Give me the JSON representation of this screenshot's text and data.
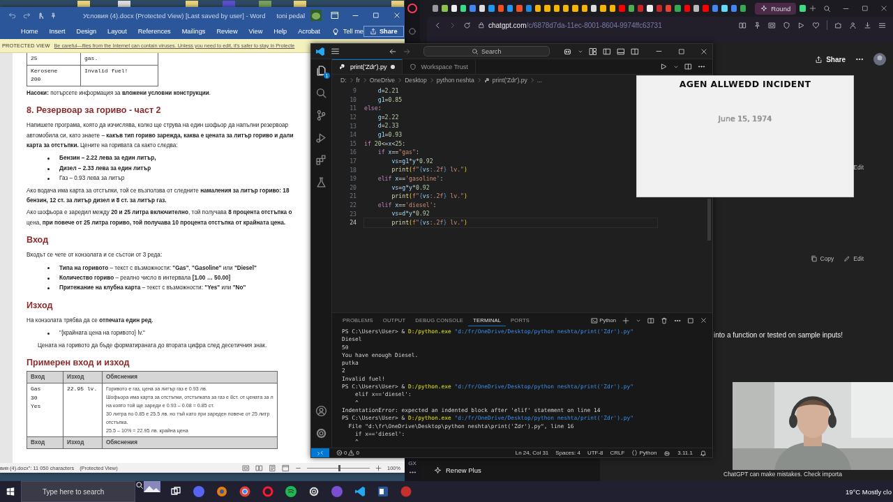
{
  "word": {
    "title": "Условия (4).docx (Protected View) [Last saved by user]  -  Word",
    "user": "toni pedal",
    "ribbon_tabs": [
      "Home",
      "Insert",
      "Design",
      "Layout",
      "References",
      "Mailings",
      "Review",
      "View",
      "Help",
      "Acrobat"
    ],
    "tell_me": "Tell me",
    "share": "Share",
    "protected_view": {
      "label": "PROTECTED VIEW",
      "message": "Be careful—files from the Internet can contain viruses. Unless you need to edit, it's safer to stay in Protecte"
    },
    "document": [
      {
        "kind": "table",
        "rows": [
          {
            "header": false,
            "cells": [
              "25",
              "gas."
            ]
          },
          {
            "header": false,
            "cells": [
              "Kerosene\n200",
              "Invalid fuel!"
            ]
          }
        ]
      },
      {
        "kind": "paragraph",
        "lines": [
          "**Насоки:** потърсете информация за **вложени условни конструкции**."
        ]
      },
      {
        "kind": "heading",
        "text": "8. Резервоар за гориво -  част 2"
      },
      {
        "kind": "paragraph",
        "lines": [
          "Напишете програма, която да изчислява, колко ще струва на един шофьор да напълни резервоар",
          "автомобила си, като знаете – **какъв тип гориво зарежда, каква е цената за литър гориво и дали**",
          "**карта за отстъпки.** Цените на горивата са както следва:"
        ]
      },
      {
        "kind": "bullets",
        "items": [
          "**Бензин – 2.22 лева за един литър,**",
          "**Дизел – 2.33 лева за един литър**",
          "Газ – 0.93 лева за литър"
        ]
      },
      {
        "kind": "paragraph",
        "lines": [
          "Ако водача има карта за отстъпки,  той се възползва от следните **намаления за литър гориво: 18**",
          "**бензин, 12 ст. за литър дизел и 8 ст. за литър газ.**"
        ]
      },
      {
        "kind": "paragraph",
        "lines": [
          "Ако шофьора е заредил между **20 и 25 литра включително**, той получава **8 процента отстъпка о**",
          "цена, **при повече от 25 литра гориво, той получава 10 процента отстъпка от крайната цена.**"
        ]
      },
      {
        "kind": "heading",
        "text": "Вход"
      },
      {
        "kind": "paragraph",
        "lines": [
          "Входът се чете от конзолата и се състои от 3 реда:"
        ]
      },
      {
        "kind": "bullets",
        "items": [
          "**Типа на горивото** – текст с възможности: **\"Gas\"**, **\"Gasoline\"** или **\"Diesel\"**",
          "**Количество гориво** – реално число в интервала **[1.00 … 50.00]**",
          "**Притежание на клубна карта** – текст с възможности: **\"Yes\"** или **\"No\"**"
        ]
      },
      {
        "kind": "heading",
        "text": "Изход"
      },
      {
        "kind": "paragraph",
        "lines": [
          "На конзолата трябва да се **отпечата един ред**."
        ]
      },
      {
        "kind": "bullets",
        "items": [
          "\"{крайната цена на горивото} lv.\""
        ]
      },
      {
        "kind": "note",
        "lines": [
          "Цената на горивото да бъде форматираната до втората цифра след десетичния знак."
        ]
      },
      {
        "kind": "heading",
        "text": "Примерен вход и изход"
      },
      {
        "kind": "table",
        "rows": [
          {
            "header": true,
            "cells": [
              "Вход",
              "Изход",
              "Обяснения"
            ]
          },
          {
            "header": false,
            "cells": [
              "Gas\n30\nYes",
              "22.95 lv.",
              "Горивото е газ, цена за литър газ е 0.93 лв.\nШофьора има карта за отстъпки, отстъпката за газ е 8ст. от цената за л\nна която той ще зареди е 0.93 – 0.08 = 0.85 ст.\n30 литра по 0.85 е 25.5 лв. но тъй като при зареден повече от 25 литр\nотстъпка.\n25.5 – 10% = 22.95 лв. крайна цена"
            ]
          },
          {
            "header": true,
            "cells": [
              "Вход",
              "Изход",
              "Обяснения"
            ]
          }
        ]
      }
    ],
    "status_bar": {
      "document_info": "вия (4).docx\": 11 050 characters",
      "mode": "(Protected View)",
      "zoom": "100%",
      "zoom_slider": {
        "level": 0.5
      }
    }
  },
  "browser": {
    "active_tab": "Round",
    "url_host": "chatgpt.com",
    "url_path": "/c/6878d7da-11ec-8001-8604-9974ffc63731",
    "sidebar_label": "GX",
    "renew": "Renew Plus",
    "share": "Share",
    "side_edit": "Edit",
    "message_actions": [
      "Copy",
      "Edit"
    ],
    "reply_fragment": "into a function or tested on sample inputs!",
    "disclaimer": "ChatGPT can make mistakes. Check importa"
  },
  "vscode": {
    "search": "Search",
    "explorer_badge": "1",
    "tabs": [
      {
        "label": "print('Zdr').py",
        "kind": "file",
        "selected": true,
        "modified": true
      },
      {
        "label": "Workspace Trust",
        "kind": "trust",
        "selected": false,
        "modified": false
      }
    ],
    "breadcrumb": [
      "D:",
      "fr",
      "OneDrive",
      "Desktop",
      "python neshta",
      "print('Zdr').py",
      "..."
    ],
    "code": [
      {
        "number": "9",
        "current": false,
        "tokens": [
          {
            "text": "    d",
            "kind": "var"
          },
          {
            "text": "=",
            "kind": "plain"
          },
          {
            "text": "2.21",
            "kind": "num"
          }
        ]
      },
      {
        "number": "10",
        "current": false,
        "tokens": [
          {
            "text": "    g1",
            "kind": "var"
          },
          {
            "text": "=",
            "kind": "plain"
          },
          {
            "text": "0.85",
            "kind": "num"
          }
        ]
      },
      {
        "number": "11",
        "current": false,
        "tokens": [
          {
            "text": "else",
            "kind": "kw"
          },
          {
            "text": ":",
            "kind": "plain"
          }
        ]
      },
      {
        "number": "12",
        "current": false,
        "tokens": [
          {
            "text": "    g",
            "kind": "var"
          },
          {
            "text": "=",
            "kind": "plain"
          },
          {
            "text": "2.22",
            "kind": "num"
          }
        ]
      },
      {
        "number": "13",
        "current": false,
        "tokens": [
          {
            "text": "    d",
            "kind": "var"
          },
          {
            "text": "=",
            "kind": "plain"
          },
          {
            "text": "2.33",
            "kind": "num"
          }
        ]
      },
      {
        "number": "14",
        "current": false,
        "tokens": [
          {
            "text": "    g1",
            "kind": "var"
          },
          {
            "text": "=",
            "kind": "plain"
          },
          {
            "text": "0.93",
            "kind": "num"
          }
        ]
      },
      {
        "number": "15",
        "current": false,
        "tokens": [
          {
            "text": "if",
            "kind": "kw"
          },
          {
            "text": " 20",
            "kind": "num"
          },
          {
            "text": "<=",
            "kind": "plain"
          },
          {
            "text": "x",
            "kind": "var"
          },
          {
            "text": "<",
            "kind": "plain"
          },
          {
            "text": "25",
            "kind": "num"
          },
          {
            "text": ":",
            "kind": "plain"
          }
        ]
      },
      {
        "number": "16",
        "current": false,
        "tokens": [
          {
            "text": "    if",
            "kind": "kw"
          },
          {
            "text": " x",
            "kind": "var"
          },
          {
            "text": "==",
            "kind": "plain"
          },
          {
            "text": "\"gas\"",
            "kind": "str"
          },
          {
            "text": ":",
            "kind": "plain"
          }
        ]
      },
      {
        "number": "17",
        "current": false,
        "tokens": [
          {
            "text": "        vs",
            "kind": "var"
          },
          {
            "text": "=",
            "kind": "plain"
          },
          {
            "text": "g1",
            "kind": "var"
          },
          {
            "text": "*",
            "kind": "plain"
          },
          {
            "text": "y",
            "kind": "var"
          },
          {
            "text": "*",
            "kind": "plain"
          },
          {
            "text": "0.92",
            "kind": "num"
          }
        ]
      },
      {
        "number": "18",
        "current": false,
        "tokens": [
          {
            "text": "        print",
            "kind": "fn"
          },
          {
            "text": "(",
            "kind": "bracket"
          },
          {
            "text": "f\"",
            "kind": "str"
          },
          {
            "text": "{",
            "kind": "fmt"
          },
          {
            "text": "vs",
            "kind": "var"
          },
          {
            "text": ":.2f",
            "kind": "str"
          },
          {
            "text": "}",
            "kind": "fmt"
          },
          {
            "text": " lv.\"",
            "kind": "str"
          },
          {
            "text": ")",
            "kind": "bracket"
          }
        ]
      },
      {
        "number": "19",
        "current": false,
        "tokens": [
          {
            "text": "    elif",
            "kind": "kw"
          },
          {
            "text": " x",
            "kind": "var"
          },
          {
            "text": "==",
            "kind": "plain"
          },
          {
            "text": "'gasoline'",
            "kind": "str"
          },
          {
            "text": ":",
            "kind": "plain"
          }
        ]
      },
      {
        "number": "20",
        "current": false,
        "tokens": [
          {
            "text": "        vs",
            "kind": "var"
          },
          {
            "text": "=",
            "kind": "plain"
          },
          {
            "text": "g",
            "kind": "var"
          },
          {
            "text": "*",
            "kind": "plain"
          },
          {
            "text": "y",
            "kind": "var"
          },
          {
            "text": "*",
            "kind": "plain"
          },
          {
            "text": "0.92",
            "kind": "num"
          }
        ]
      },
      {
        "number": "21",
        "current": false,
        "tokens": [
          {
            "text": "        print",
            "kind": "fn"
          },
          {
            "text": "(",
            "kind": "bracket"
          },
          {
            "text": "f\"",
            "kind": "str"
          },
          {
            "text": "{",
            "kind": "fmt"
          },
          {
            "text": "vs",
            "kind": "var"
          },
          {
            "text": ":.2f",
            "kind": "str"
          },
          {
            "text": "}",
            "kind": "fmt"
          },
          {
            "text": " lv.\"",
            "kind": "str"
          },
          {
            "text": ")",
            "kind": "bracket"
          }
        ]
      },
      {
        "number": "22",
        "current": false,
        "tokens": [
          {
            "text": "    elif",
            "kind": "kw"
          },
          {
            "text": " x",
            "kind": "var"
          },
          {
            "text": "==",
            "kind": "plain"
          },
          {
            "text": "'diesel'",
            "kind": "str"
          },
          {
            "text": ":",
            "kind": "plain"
          }
        ]
      },
      {
        "number": "23",
        "current": false,
        "tokens": [
          {
            "text": "        vs",
            "kind": "var"
          },
          {
            "text": "=",
            "kind": "plain"
          },
          {
            "text": "d",
            "kind": "var"
          },
          {
            "text": "*",
            "kind": "plain"
          },
          {
            "text": "y",
            "kind": "var"
          },
          {
            "text": "*",
            "kind": "plain"
          },
          {
            "text": "0.92",
            "kind": "num"
          }
        ]
      },
      {
        "number": "24",
        "current": true,
        "tokens": [
          {
            "text": "        print",
            "kind": "fn"
          },
          {
            "text": "(",
            "kind": "bracket"
          },
          {
            "text": "f\"",
            "kind": "str"
          },
          {
            "text": "{",
            "kind": "fmt"
          },
          {
            "text": "vs",
            "kind": "var"
          },
          {
            "text": ":.2f",
            "kind": "str"
          },
          {
            "text": "}",
            "kind": "fmt"
          },
          {
            "text": " lv.\"",
            "kind": "str"
          },
          {
            "text": ")",
            "kind": "bracket"
          }
        ]
      }
    ],
    "panel_tabs": [
      {
        "label": "PROBLEMS",
        "selected": false
      },
      {
        "label": "OUTPUT",
        "selected": false
      },
      {
        "label": "DEBUG CONSOLE",
        "selected": false
      },
      {
        "label": "TERMINAL",
        "selected": true
      },
      {
        "label": "PORTS",
        "selected": false
      }
    ],
    "terminal_name": "Python",
    "terminal": [
      [
        {
          "text": "PS C:\\Users\\User> &",
          "kind": "plain"
        },
        {
          "text": " D:/python.exe",
          "kind": "cmd"
        },
        {
          "text": " \"d:/fr/OneDrive/Desktop/python neshta/print('Zdr').py\"",
          "kind": "path"
        }
      ],
      [
        {
          "text": "Diesel",
          "kind": "plain"
        }
      ],
      [
        {
          "text": "50",
          "kind": "plain"
        }
      ],
      [
        {
          "text": "You have enough Diesel.",
          "kind": "plain"
        }
      ],
      [
        {
          "text": "putka",
          "kind": "plain"
        }
      ],
      [
        {
          "text": "2",
          "kind": "plain"
        }
      ],
      [
        {
          "text": "Invalid fuel!",
          "kind": "plain"
        }
      ],
      [
        {
          "text": "PS C:\\Users\\User> &",
          "kind": "plain"
        },
        {
          "text": " D:/python.exe",
          "kind": "cmd"
        },
        {
          "text": " \"d:/fr/OneDrive/Desktop/python neshta/print('Zdr').py\"",
          "kind": "path"
        }
      ],
      [
        {
          "text": "    elif x=='diesel':",
          "kind": "plain"
        }
      ],
      [
        {
          "text": "    ^",
          "kind": "plain"
        }
      ],
      [
        {
          "text": "IndentationError: expected an indented block after 'elif' statement on line 14",
          "kind": "plain"
        }
      ],
      [
        {
          "text": "PS C:\\Users\\User> &",
          "kind": "plain"
        },
        {
          "text": " D:/python.exe",
          "kind": "cmd"
        },
        {
          "text": " \"d:/fr/OneDrive/Desktop/python neshta/print('Zdr').py\"",
          "kind": "path"
        }
      ],
      [
        {
          "text": "  File \"d:\\fr\\OneDrive\\Desktop\\python neshta\\print('Zdr').py\", line 16",
          "kind": "plain"
        }
      ],
      [
        {
          "text": "    if x=='diesel':",
          "kind": "plain"
        }
      ],
      [
        {
          "text": "    ^",
          "kind": "plain"
        }
      ]
    ],
    "status": {
      "errors": "0",
      "warnings": "0",
      "position": "Ln 24, Col 31",
      "indent": "Spaces: 4",
      "encoding": "UTF-8",
      "eol": "CRLF",
      "language": "Python",
      "version": "3.11.1"
    }
  },
  "image_card": {
    "title": "AGEN ALLWEDD INCIDENT",
    "date": "June 15, 1974"
  },
  "taskbar": {
    "search_placeholder": "Type here to search",
    "weather": "19°C Mostly clo"
  }
}
